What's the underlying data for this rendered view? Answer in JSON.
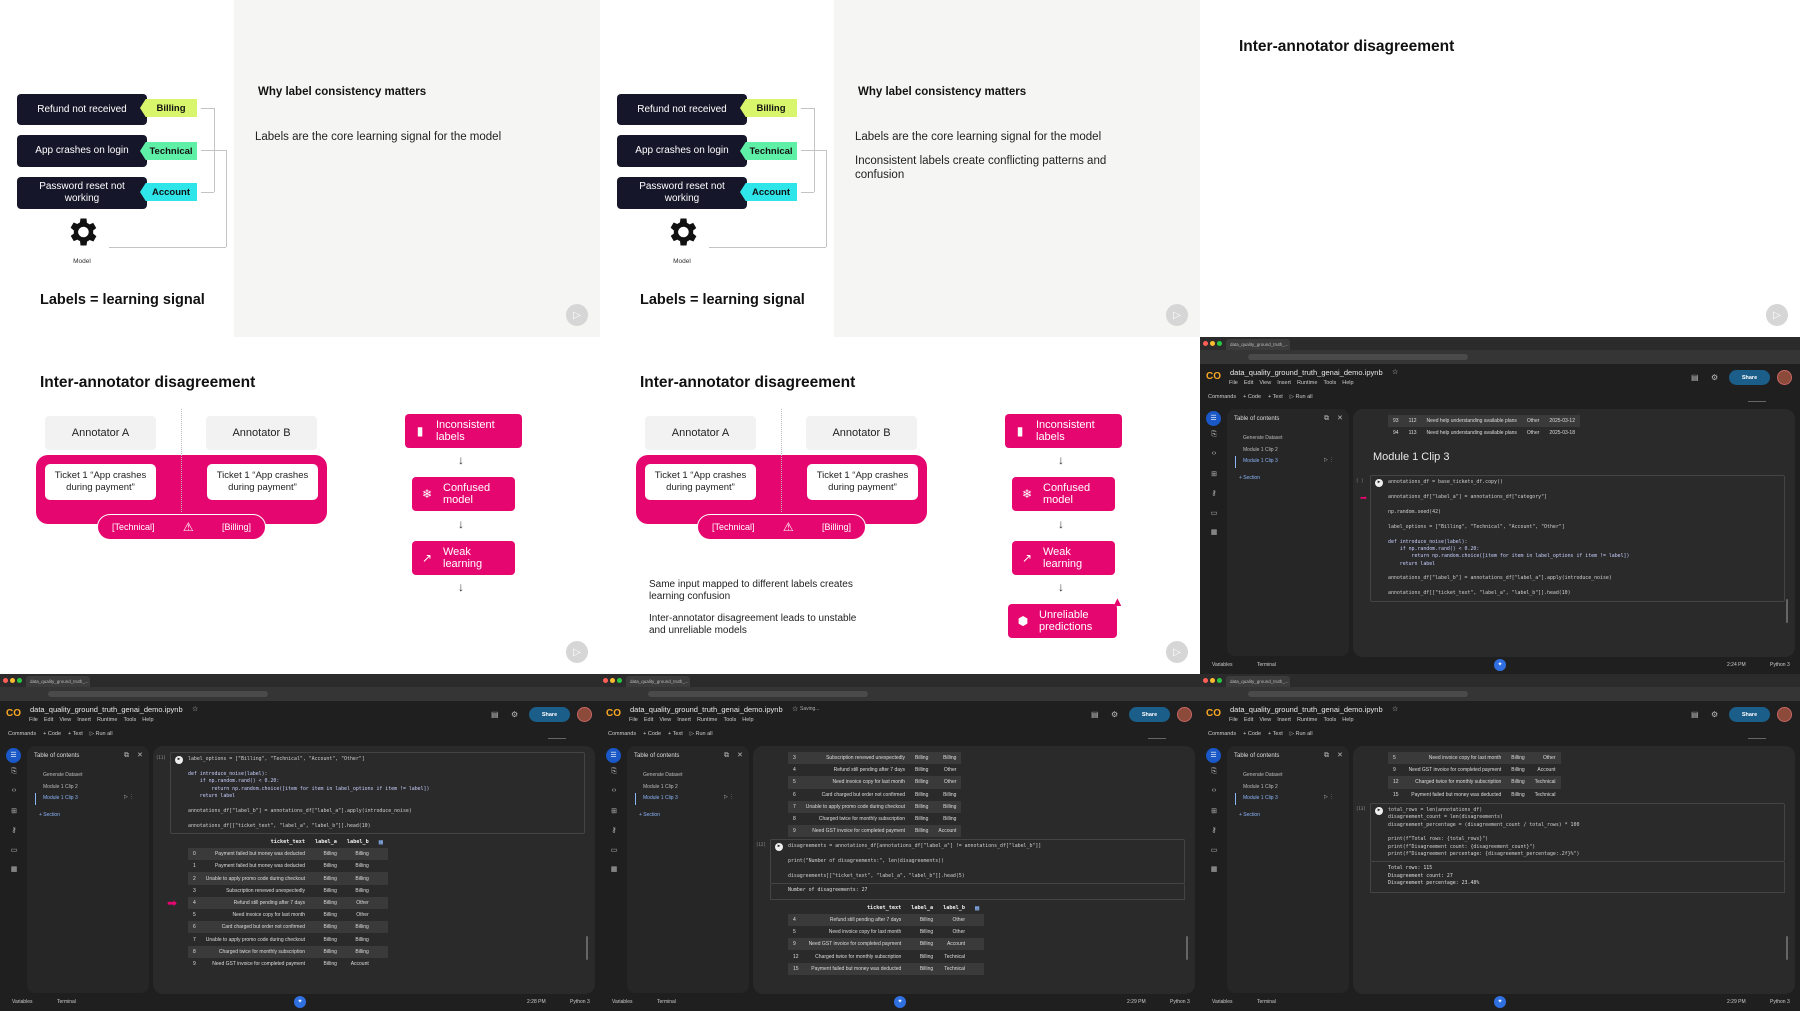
{
  "colors": {
    "pink": "#e6066f",
    "billing_tag": "#d8f56b",
    "technical_tag": "#5ff0a8",
    "account_tag": "#2ee6ea",
    "ticket_dark": "#16162a",
    "colab_accent": "#1a57c7"
  },
  "slide_labels": {
    "tickets": [
      "Refund not received",
      "App crashes on login",
      "Password reset not working"
    ],
    "tags": [
      "Billing",
      "Technical",
      "Account"
    ],
    "model_label": "Model",
    "caption": "Labels = learning signal",
    "heading": "Why label consistency matters",
    "bullet1": "Labels are the core learning signal for the model",
    "bullet2": "Inconsistent labels create conflicting patterns and confusion"
  },
  "slide_disagreement": {
    "title": "Inter-annotator disagreement",
    "annotator_a": "Annotator A",
    "annotator_b": "Annotator B",
    "ticket_text": "Ticket 1 “App crashes during payment”",
    "label_a": "[Technical]",
    "label_b": "[Billing]",
    "flow": [
      "Inconsistent labels",
      "Confused model",
      "Weak learning",
      "Unreliable predictions"
    ],
    "text1": "Same input mapped to different labels creates learning confusion",
    "text2": "Inter-annotator disagreement leads to unstable and unreliable models"
  },
  "colab": {
    "tab_title": "data_quality_ground_truth_...",
    "notebook_title": "data_quality_ground_truth_genai_demo.ipynb",
    "menu": [
      "File",
      "Edit",
      "View",
      "Insert",
      "Runtime",
      "Tools",
      "Help"
    ],
    "toolbar": [
      "Commands",
      "+ Code",
      "+ Text",
      "▷ Run all"
    ],
    "share": "Share",
    "toc_title": "Table of contents",
    "toc_items": [
      "Generate Dataset",
      "Module 1 Clip 2",
      "Module 1 Clip 3"
    ],
    "toc_add": "+ Section",
    "variables": "Variables",
    "terminal": "Terminal",
    "runtime": "Python 3",
    "saving": "Saving..."
  },
  "notebooks": [
    {
      "time": "2:24 PM",
      "blocks": [
        {
          "type": "table",
          "rows": [
            [
              "93",
              "112",
              "Need help understanding available plans",
              "Other",
              "2025-03-12"
            ],
            [
              "94",
              "113",
              "Need help understanding available plans",
              "Other",
              "2025-03-18"
            ]
          ]
        },
        {
          "type": "heading",
          "text": "Module 1 Clip 3"
        },
        {
          "type": "code",
          "exec": "[ ]",
          "arrow_line": 2,
          "lines": [
            "annotations_df = base_tickets_df.copy()",
            "",
            "annotations_df[\"label_a\"] = annotations_df[\"category\"]",
            "",
            "np.random.seed(42)",
            "",
            "label_options = [\"Billing\", \"Technical\", \"Account\", \"Other\"]",
            "",
            "def introduce_noise(label):",
            "    if np.random.rand() < 0.20:",
            "        return np.random.choice([item for item in label_options if item != label])",
            "    return label",
            "",
            "annotations_df[\"label_b\"] = annotations_df[\"label_a\"].apply(introduce_noise)",
            "",
            "annotations_df[[\"ticket_text\", \"label_a\", \"label_b\"]].head(10)"
          ]
        }
      ]
    },
    {
      "time": "2:28 PM",
      "blocks": [
        {
          "type": "code",
          "exec": "[11]",
          "lines": [
            "label_options = [\"Billing\", \"Technical\", \"Account\", \"Other\"]",
            "",
            "def introduce_noise(label):",
            "    if np.random.rand() < 0.20:",
            "        return np.random.choice([item for item in label_options if item != label])",
            "    return label",
            "",
            "annotations_df[\"label_b\"] = annotations_df[\"label_a\"].apply(introduce_noise)",
            "",
            "annotations_df[[\"ticket_text\", \"label_a\", \"label_b\"]].head(10)"
          ]
        },
        {
          "type": "table",
          "output": true,
          "arrow_row": 4,
          "columns": [
            "",
            "ticket_text",
            "label_a",
            "label_b"
          ],
          "rows": [
            [
              "0",
              "Payment failed but money was deducted",
              "Billing",
              "Billing"
            ],
            [
              "1",
              "Payment failed but money was deducted",
              "Billing",
              "Billing"
            ],
            [
              "2",
              "Unable to apply promo code during checkout",
              "Billing",
              "Billing"
            ],
            [
              "3",
              "Subscription renewed unexpectedly",
              "Billing",
              "Billing"
            ],
            [
              "4",
              "Refund still pending after 7 days",
              "Billing",
              "Other"
            ],
            [
              "5",
              "Need invoice copy for last month",
              "Billing",
              "Other"
            ],
            [
              "6",
              "Card charged but order not confirmed",
              "Billing",
              "Billing"
            ],
            [
              "7",
              "Unable to apply promo code during checkout",
              "Billing",
              "Billing"
            ],
            [
              "8",
              "Charged twice for monthly subscription",
              "Billing",
              "Billing"
            ],
            [
              "9",
              "Need GST invoice for completed payment",
              "Billing",
              "Account"
            ]
          ]
        }
      ]
    },
    {
      "time": "2:29 PM",
      "saving": true,
      "blocks": [
        {
          "type": "table",
          "rows": [
            [
              "3",
              "Subscription renewed unexpectedly",
              "Billing",
              "Billing"
            ],
            [
              "4",
              "Refund still pending after 7 days",
              "Billing",
              "Other"
            ],
            [
              "5",
              "Need invoice copy for last month",
              "Billing",
              "Other"
            ],
            [
              "6",
              "Card charged but order not confirmed",
              "Billing",
              "Billing"
            ],
            [
              "7",
              "Unable to apply promo code during checkout",
              "Billing",
              "Billing"
            ],
            [
              "8",
              "Charged twice for monthly subscription",
              "Billing",
              "Billing"
            ],
            [
              "9",
              "Need GST invoice for completed payment",
              "Billing",
              "Account"
            ]
          ]
        },
        {
          "type": "code",
          "exec": "[12]",
          "lines": [
            "disagreements = annotations_df[annotations_df[\"label_a\"] != annotations_df[\"label_b\"]]",
            "",
            "print(\"Number of disagreements:\", len(disagreements))",
            "",
            "disagreements[[\"ticket_text\", \"label_a\", \"label_b\"]].head(5)"
          ]
        },
        {
          "type": "output",
          "lines": [
            "Number of disagreements: 27"
          ]
        },
        {
          "type": "table",
          "output": true,
          "columns": [
            "",
            "ticket_text",
            "label_a",
            "label_b"
          ],
          "rows": [
            [
              "4",
              "Refund still pending after 7 days",
              "Billing",
              "Other"
            ],
            [
              "5",
              "Need invoice copy for last month",
              "Billing",
              "Other"
            ],
            [
              "9",
              "Need GST invoice for completed payment",
              "Billing",
              "Account"
            ],
            [
              "12",
              "Charged twice for monthly subscription",
              "Billing",
              "Technical"
            ],
            [
              "15",
              "Payment failed but money was deducted",
              "Billing",
              "Technical"
            ]
          ]
        }
      ]
    },
    {
      "time": "2:29 PM",
      "blocks": [
        {
          "type": "table",
          "rows": [
            [
              "5",
              "Need invoice copy for last month",
              "Billing",
              "Other"
            ],
            [
              "9",
              "Need GST invoice for completed payment",
              "Billing",
              "Account"
            ],
            [
              "12",
              "Charged twice for monthly subscription",
              "Billing",
              "Technical"
            ],
            [
              "15",
              "Payment failed but money was deducted",
              "Billing",
              "Technical"
            ]
          ]
        },
        {
          "type": "code",
          "exec": "[13]",
          "lines": [
            "total_rows = len(annotations_df)",
            "disagreement_count = len(disagreements)",
            "disagreement_percentage = (disagreement_count / total_rows) * 100",
            "",
            "print(f\"Total rows: {total_rows}\")",
            "print(f\"Disagreement count: {disagreement_count}\")",
            "print(f\"Disagreement percentage: {disagreement_percentage:.2f}%\")"
          ]
        },
        {
          "type": "output",
          "lines": [
            "Total rows: 115",
            "Disagreement count: 27",
            "Disagreement percentage: 23.48%"
          ]
        }
      ]
    }
  ]
}
